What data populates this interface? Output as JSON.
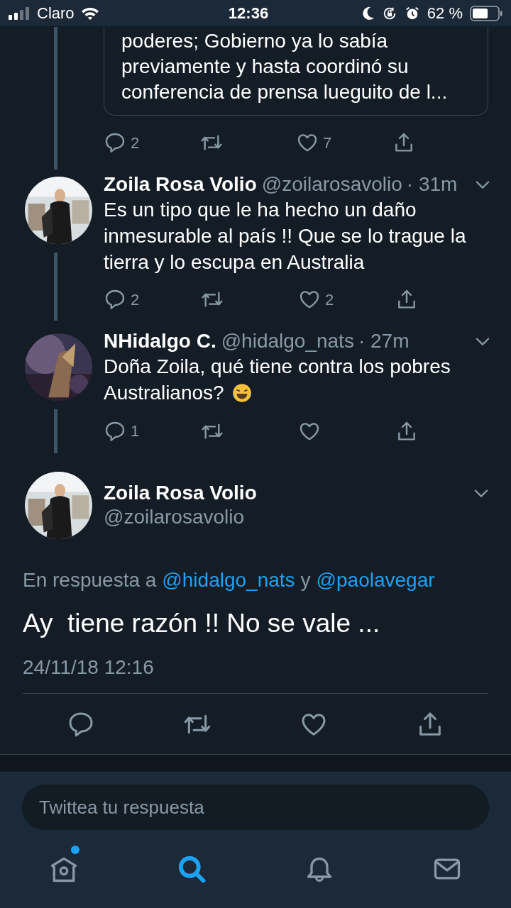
{
  "status_bar": {
    "carrier": "Claro",
    "time": "12:36",
    "battery_text": "62 %"
  },
  "quoted_card": {
    "lines": [
      "poderes; Gobierno ya lo sabía",
      "previamente y hasta coordinó su",
      "conferencia de prensa lueguito de l..."
    ],
    "actions": {
      "replies": "2",
      "likes": "7"
    }
  },
  "replies": [
    {
      "name": "Zoila Rosa Volio",
      "handle": "@zoilarosavolio",
      "time": "· 31m",
      "text_lines": [
        "Es un tipo que le ha hecho un daño",
        "inmesurable al país !! Que se lo trague la",
        "tierra y lo escupa en Australia"
      ],
      "emoji": false,
      "actions": {
        "replies": "2",
        "likes": "2"
      }
    },
    {
      "name": "NHidalgo C.",
      "handle": "@hidalgo_nats",
      "time": "· 27m",
      "text_lines": [
        "Doña Zoila, qué tiene contra los pobres",
        "Australianos?"
      ],
      "emoji": true,
      "actions": {
        "replies": "1"
      }
    }
  ],
  "main_tweet": {
    "name": "Zoila Rosa Volio",
    "handle": "@zoilarosavolio",
    "reply_to": {
      "prefix": "En respuesta a",
      "mentions": [
        "@hidalgo_nats",
        "@paolavegar"
      ],
      "joiner": "y"
    },
    "text": "Ay  tiene razón !! No se vale ...",
    "date": "24/11/18 12:16"
  },
  "reply_box": {
    "placeholder": "Twittea tu respuesta"
  },
  "tab_bar": [
    {
      "kind": "home",
      "selected": false,
      "badge": true
    },
    {
      "kind": "search",
      "selected": true,
      "badge": false
    },
    {
      "kind": "notifications",
      "selected": false,
      "badge": false
    },
    {
      "kind": "messages",
      "selected": false,
      "badge": false
    }
  ]
}
